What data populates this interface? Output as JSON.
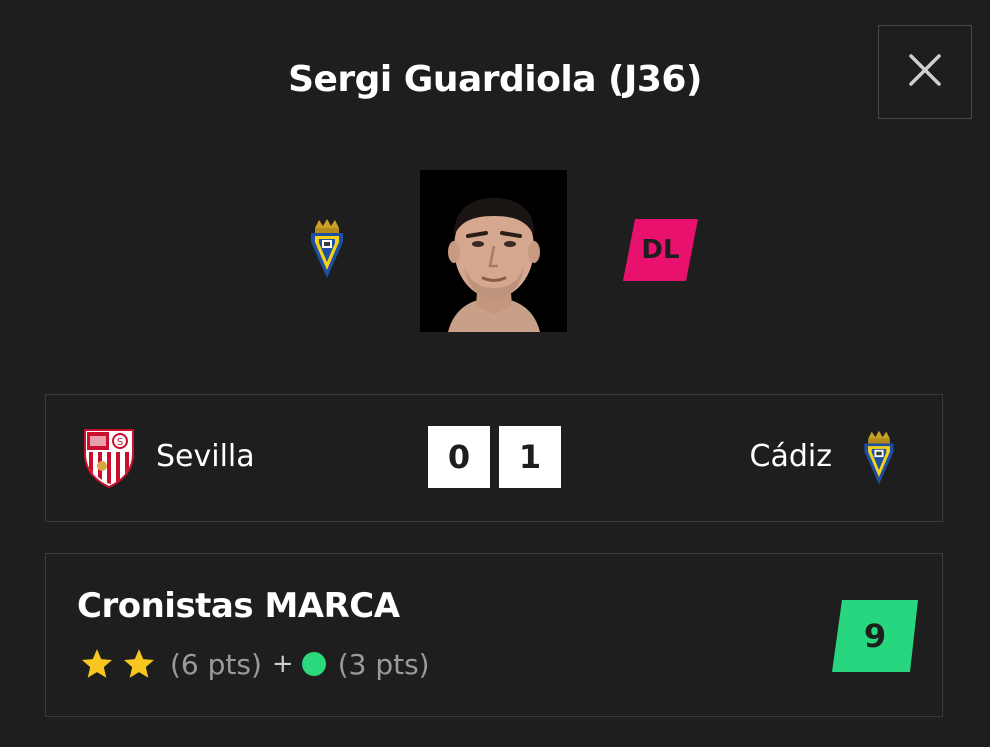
{
  "player": {
    "title": "Sergi Guardiola (J36)",
    "position": "DL"
  },
  "match": {
    "home_team": "Sevilla",
    "away_team": "Cádiz",
    "home_score": "0",
    "away_score": "1"
  },
  "rating": {
    "title": "Cronistas MARCA",
    "stars_count": 2,
    "stars_points": "(6 pts)",
    "plus": "+",
    "bonus_points": "(3 pts)",
    "total": "9"
  },
  "colors": {
    "background": "#1e1e1e",
    "position_badge": "#e8126e",
    "score_badge": "#27d67e",
    "bonus_dot": "#2bd97c",
    "star": "#f6c81f",
    "border": "#3a3a3a"
  },
  "icons": {
    "close": "close-icon",
    "team_crest": "cadiz-crest-icon",
    "home_crest": "sevilla-crest-icon",
    "star": "star-icon",
    "bonus": "green-dot-icon"
  }
}
